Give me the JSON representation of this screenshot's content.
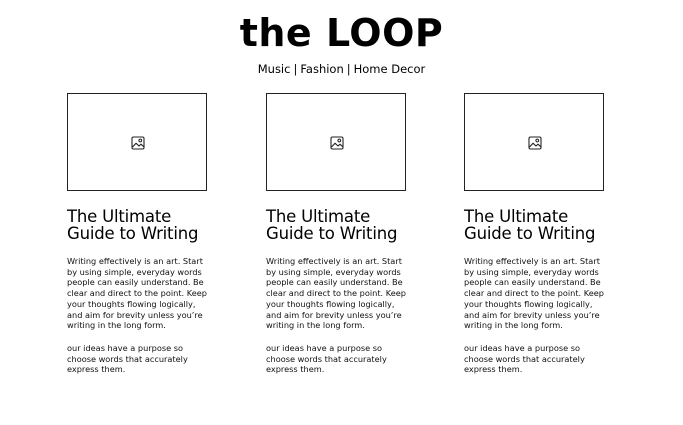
{
  "header": {
    "title": "the LOOP",
    "nav": [
      {
        "label": "Music"
      },
      {
        "label": "Fashion"
      },
      {
        "label": "Home Decor"
      }
    ],
    "separator": "|"
  },
  "cards": [
    {
      "image_icon": "image-icon",
      "title_line1": "The Ultimate",
      "title_line2": "Guide to Writing",
      "paragraph1": "Writing effectively is an art. Start by using simple, everyday words people can easily understand. Be clear and direct to the point. Keep your thoughts flowing logically, and aim for brevity unless you’re writing in the long form.",
      "paragraph2": "our ideas have a purpose so choose words that accurately express them."
    },
    {
      "image_icon": "image-icon",
      "title_line1": "The Ultimate",
      "title_line2": "Guide to Writing",
      "paragraph1": "Writing effectively is an art. Start by using simple, everyday words people can easily understand. Be clear and direct to the point. Keep your thoughts flowing logically, and aim for brevity unless you’re writing in the long form.",
      "paragraph2": "our ideas have a purpose so choose words that accurately express them."
    },
    {
      "image_icon": "image-icon",
      "title_line1": "The Ultimate",
      "title_line2": "Guide to Writing",
      "paragraph1": "Writing effectively is an art. Start by using simple, everyday words people can easily understand. Be clear and direct to the point. Keep your thoughts flowing logically, and aim for brevity unless you’re writing in the long form.",
      "paragraph2": "our ideas have a purpose so choose words that accurately express them."
    }
  ]
}
